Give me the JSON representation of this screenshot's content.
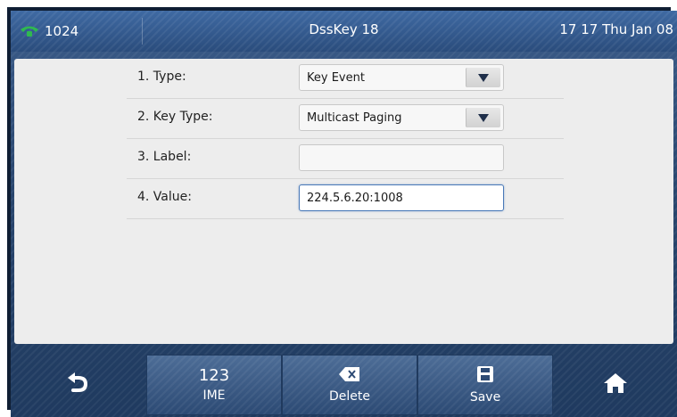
{
  "status_bar": {
    "account": "1024",
    "title": "DssKey 18",
    "clock": "17 17 Thu Jan 08"
  },
  "form": {
    "rows": [
      {
        "label": "1. Type:",
        "value": "Key Event",
        "kind": "dropdown"
      },
      {
        "label": "2. Key Type:",
        "value": "Multicast Paging",
        "kind": "dropdown"
      },
      {
        "label": "3. Label:",
        "value": "",
        "kind": "text"
      },
      {
        "label": "4. Value:",
        "value": "224.5.6.20:1008",
        "kind": "text",
        "focused": true
      }
    ]
  },
  "softkeys": {
    "back": {
      "icon": "back-arrow-icon"
    },
    "ime": {
      "top": "123",
      "label": "IME"
    },
    "delete": {
      "icon": "backspace-icon",
      "label": "Delete"
    },
    "save": {
      "icon": "floppy-disk-icon",
      "label": "Save"
    },
    "home": {
      "icon": "home-icon"
    }
  },
  "colors": {
    "status_bar": "#2f5487",
    "panel": "#ededed",
    "phone_icon": "#2fb94f",
    "focus_border": "#4a79b8"
  }
}
